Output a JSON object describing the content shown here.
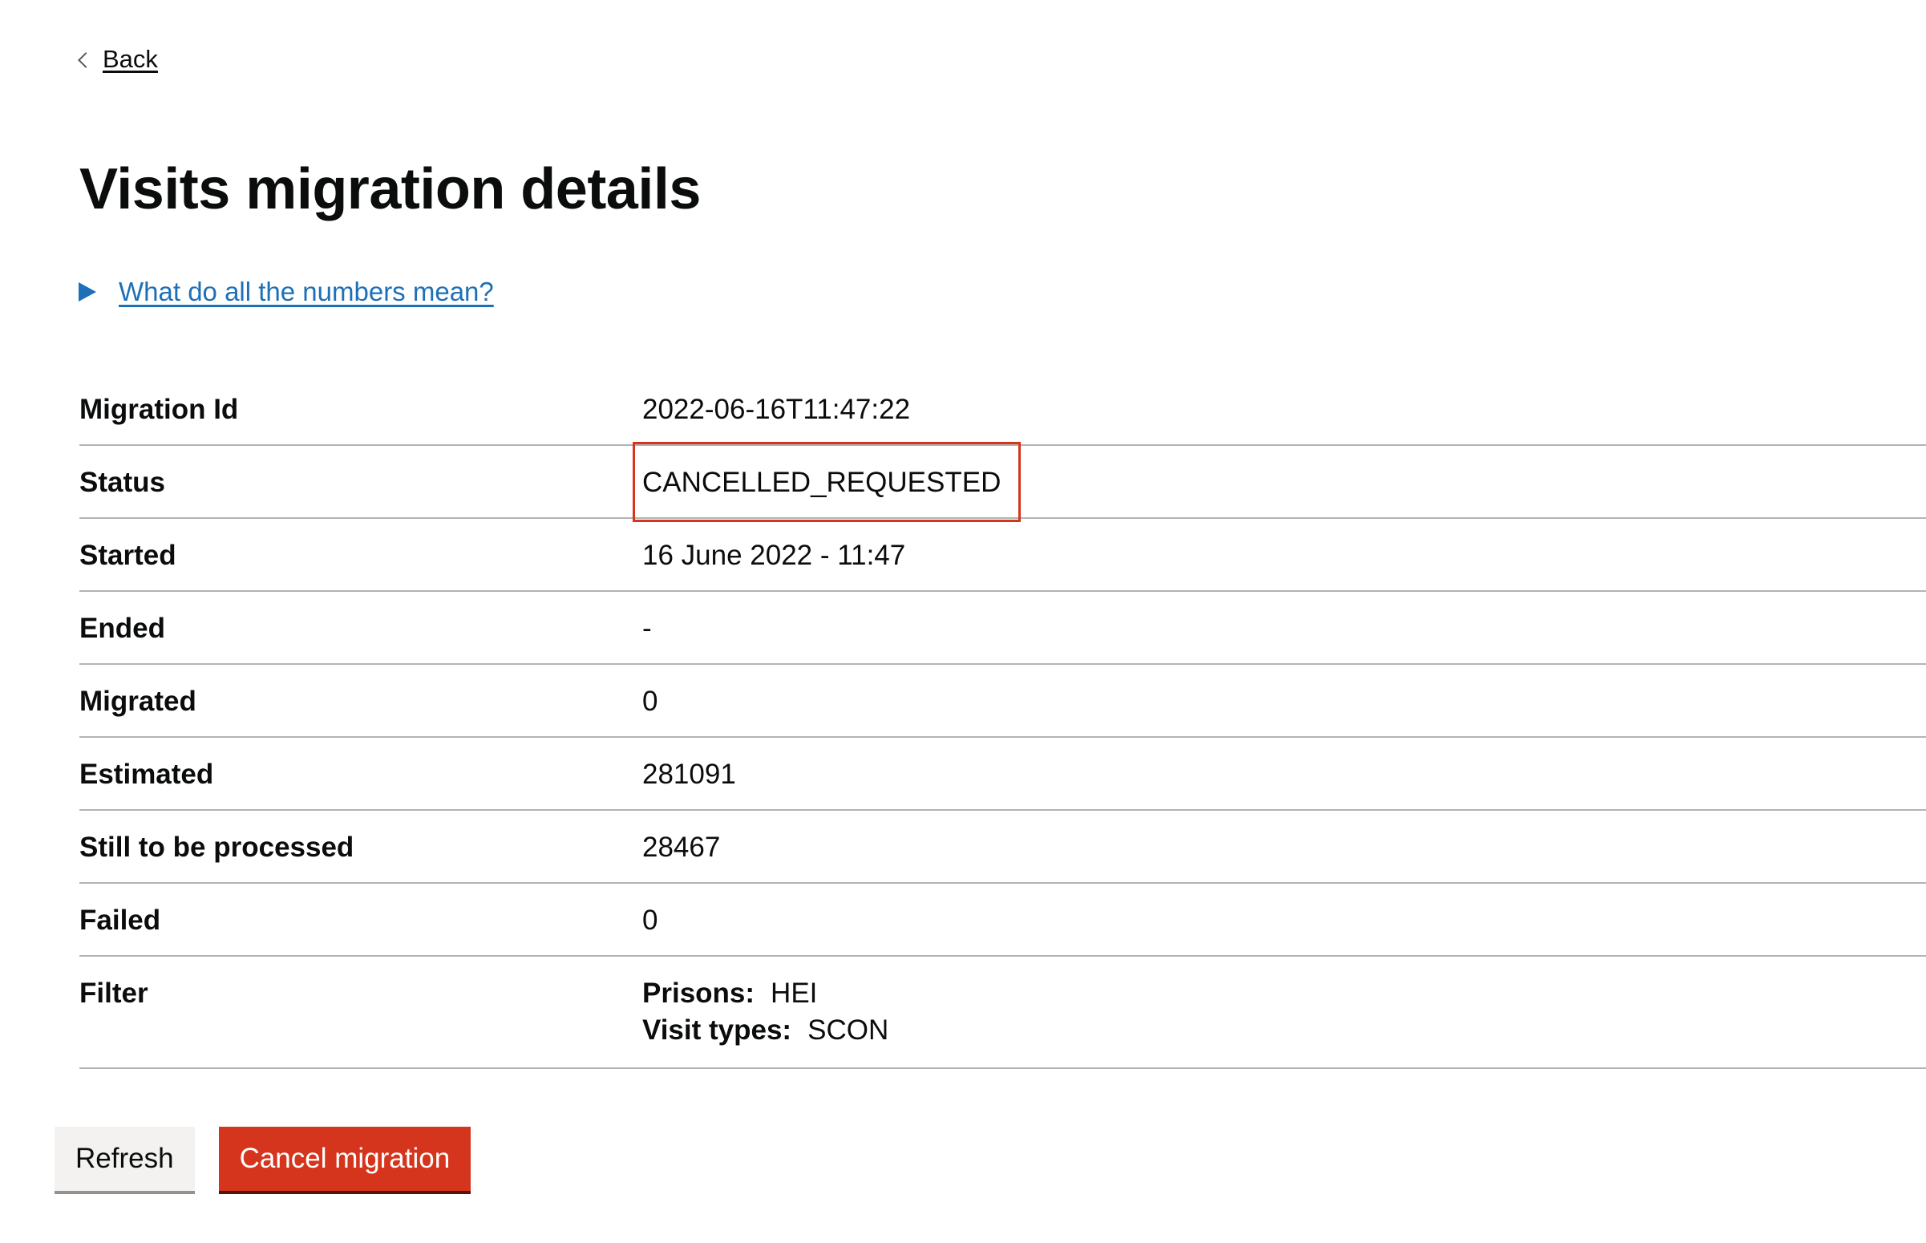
{
  "back": {
    "label": "Back"
  },
  "page_title": "Visits migration details",
  "help": {
    "summary": "What do all the numbers mean?"
  },
  "details": [
    {
      "key": "Migration Id",
      "value": "2022-06-16T11:47:22"
    },
    {
      "key": "Status",
      "value": "CANCELLED_REQUESTED"
    },
    {
      "key": "Started",
      "value": "16 June 2022 - 11:47"
    },
    {
      "key": "Ended",
      "value": "-"
    },
    {
      "key": "Migrated",
      "value": "0"
    },
    {
      "key": "Estimated",
      "value": "281091"
    },
    {
      "key": "Still to be processed",
      "value": "28467"
    },
    {
      "key": "Failed",
      "value": "0"
    }
  ],
  "filter": {
    "key": "Filter",
    "prisons_label": "Prisons:",
    "prisons_value": "HEI",
    "visit_types_label": "Visit types:",
    "visit_types_value": "SCON"
  },
  "buttons": {
    "refresh": "Refresh",
    "cancel": "Cancel migration"
  },
  "colors": {
    "link": "#1d70b8",
    "warning": "#d4351c",
    "highlight": "#d4351c",
    "border": "#b1b4b6"
  }
}
